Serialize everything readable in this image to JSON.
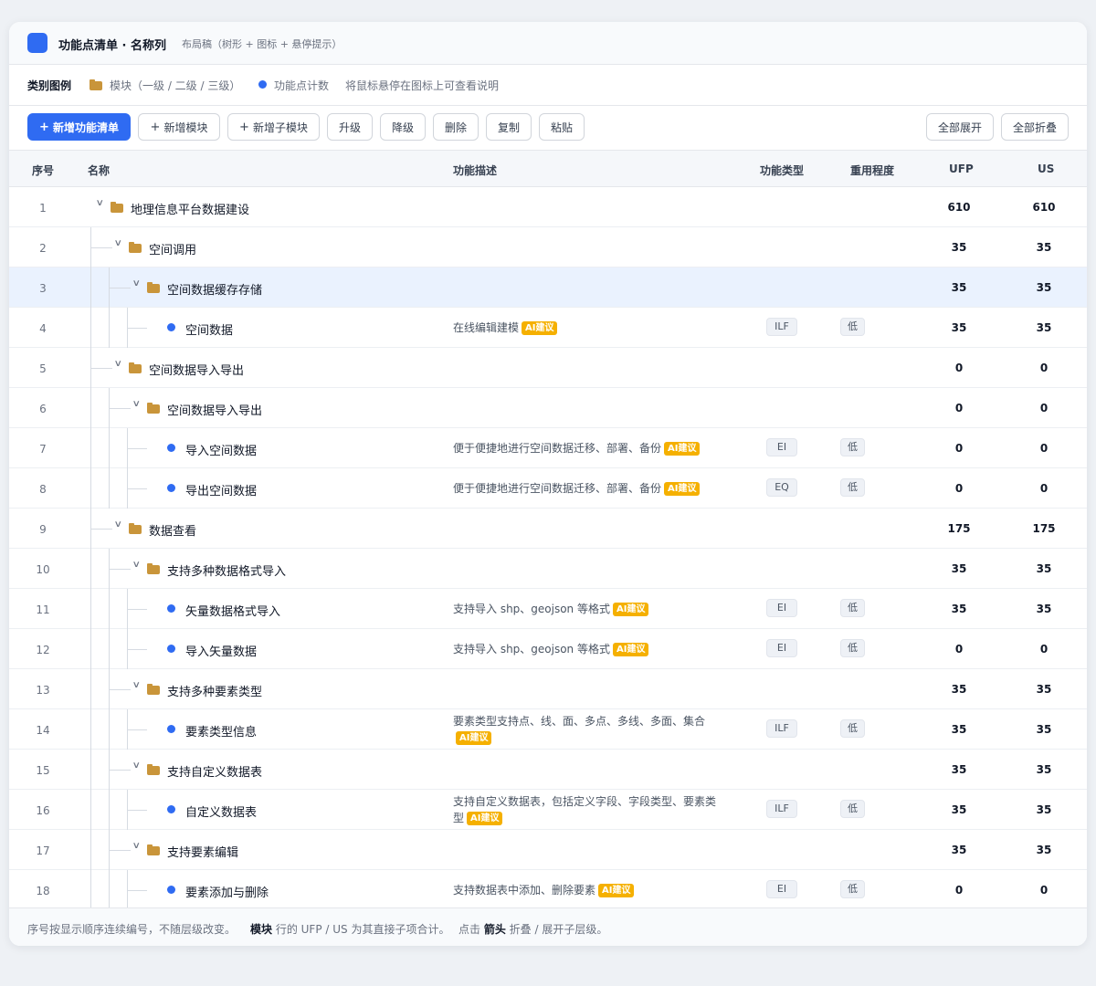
{
  "header": {
    "title": "功能点清单 · 名称列",
    "subtitle": "布局稿（树形 + 图标 + 悬停提示）"
  },
  "legend": {
    "title": "类别图例",
    "module": "模块（一级 / 二级 / 三级）",
    "fp": "功能点计数",
    "hint": "将鼠标悬停在图标上可查看说明"
  },
  "toolbar": {
    "new_list": "新增功能清单",
    "add_module": "新增模块",
    "add_sub": "新增子模块",
    "upgrade": "升级",
    "downgrade": "降级",
    "delete": "删除",
    "copy": "复制",
    "paste": "粘贴",
    "expand_all": "全部展开",
    "collapse_all": "全部折叠"
  },
  "columns": {
    "idx": "序号",
    "name": "名称",
    "desc": "功能描述",
    "type": "功能类型",
    "reuse": "重用程度",
    "ufp": "UFP",
    "us": "US"
  },
  "ai_label": "AI建议",
  "rows": [
    {
      "idx": "1",
      "name": "地理信息平台数据建设",
      "kind": "module",
      "level": 1,
      "ufp": "610",
      "us": "610"
    },
    {
      "idx": "2",
      "name": "空间调用",
      "kind": "module",
      "level": 2,
      "ufp": "35",
      "us": "35"
    },
    {
      "idx": "3",
      "name": "空间数据缓存存储",
      "kind": "module",
      "level": 3,
      "ufp": "35",
      "us": "35",
      "selected": true
    },
    {
      "idx": "4",
      "name": "空间数据",
      "kind": "fp",
      "desc": "在线编辑建模",
      "type": "ILF",
      "reuse": "低",
      "ufp": "35",
      "us": "35"
    },
    {
      "idx": "5",
      "name": "空间数据导入导出",
      "kind": "module",
      "level": 2,
      "ufp": "0",
      "us": "0"
    },
    {
      "idx": "6",
      "name": "空间数据导入导出",
      "kind": "module",
      "level": 3,
      "ufp": "0",
      "us": "0"
    },
    {
      "idx": "7",
      "name": "导入空间数据",
      "kind": "fp",
      "desc": "便于便捷地进行空间数据迁移、部署、备份",
      "type": "EI",
      "reuse": "低",
      "ufp": "0",
      "us": "0"
    },
    {
      "idx": "8",
      "name": "导出空间数据",
      "kind": "fp",
      "desc": "便于便捷地进行空间数据迁移、部署、备份",
      "type": "EQ",
      "reuse": "低",
      "ufp": "0",
      "us": "0"
    },
    {
      "idx": "9",
      "name": "数据查看",
      "kind": "module",
      "level": 2,
      "ufp": "175",
      "us": "175"
    },
    {
      "idx": "10",
      "name": "支持多种数据格式导入",
      "kind": "module",
      "level": 3,
      "ufp": "35",
      "us": "35"
    },
    {
      "idx": "11",
      "name": "矢量数据格式导入",
      "kind": "fp",
      "desc": "支持导入 shp、geojson 等格式",
      "type": "EI",
      "reuse": "低",
      "ufp": "35",
      "us": "35"
    },
    {
      "idx": "12",
      "name": "导入矢量数据",
      "kind": "fp",
      "desc": "支持导入 shp、geojson 等格式",
      "type": "EI",
      "reuse": "低",
      "ufp": "0",
      "us": "0"
    },
    {
      "idx": "13",
      "name": "支持多种要素类型",
      "kind": "module",
      "level": 3,
      "ufp": "35",
      "us": "35"
    },
    {
      "idx": "14",
      "name": "要素类型信息",
      "kind": "fp",
      "desc": "要素类型支持点、线、面、多点、多线、多面、集合",
      "type": "ILF",
      "reuse": "低",
      "ufp": "35",
      "us": "35",
      "wrap": true
    },
    {
      "idx": "15",
      "name": "支持自定义数据表",
      "kind": "module",
      "level": 3,
      "ufp": "35",
      "us": "35"
    },
    {
      "idx": "16",
      "name": "自定义数据表",
      "kind": "fp",
      "desc": "支持自定义数据表，包括定义字段、字段类型、要素类型",
      "type": "ILF",
      "reuse": "低",
      "ufp": "35",
      "us": "35",
      "wrap": true
    },
    {
      "idx": "17",
      "name": "支持要素编辑",
      "kind": "module",
      "level": 3,
      "ufp": "35",
      "us": "35"
    },
    {
      "idx": "18",
      "name": "要素添加与删除",
      "kind": "fp",
      "desc": "支持数据表中添加、删除要素",
      "type": "EI",
      "reuse": "低",
      "ufp": "0",
      "us": "0"
    }
  ],
  "footer": {
    "note1": "序号按显示顺序连续编号，不随层级改变。",
    "note2_bold": "模块",
    "note2": " 行的 UFP / US 为其直接子项合计。",
    "note3_pre": "点击 ",
    "note3_bold": "箭头",
    "note3": " 折叠 / 展开子层级。"
  },
  "colors": {
    "primary": "#2f6bf2",
    "folder": "#c9953a",
    "ai_badge": "#f5b000",
    "selected_row": "#eaf2fe"
  }
}
